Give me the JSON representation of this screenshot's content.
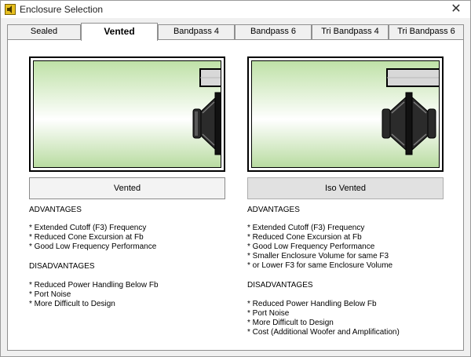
{
  "window": {
    "title": "Enclosure Selection",
    "close_symbol": "✕"
  },
  "tabs": [
    {
      "label": "Sealed",
      "active": false
    },
    {
      "label": "Vented",
      "active": true
    },
    {
      "label": "Bandpass 4",
      "active": false
    },
    {
      "label": "Bandpass 6",
      "active": false
    },
    {
      "label": "Tri Bandpass 4",
      "active": false
    },
    {
      "label": "Tri Bandpass 6",
      "active": false
    }
  ],
  "options": [
    {
      "button_label": "Vented",
      "advantages_heading": "ADVANTAGES",
      "advantages": [
        "* Extended Cutoff (F3) Frequency",
        "* Reduced Cone Excursion at Fb",
        "* Good Low Frequency Performance"
      ],
      "disadvantages_heading": "DISADVANTAGES",
      "disadvantages": [
        "* Reduced Power Handling Below Fb",
        "* Port Noise",
        "* More Difficult to Design"
      ]
    },
    {
      "button_label": "Iso Vented",
      "advantages_heading": "ADVANTAGES",
      "advantages": [
        "* Extended Cutoff (F3) Frequency",
        "* Reduced Cone Excursion at Fb",
        "* Good Low Frequency Performance",
        "* Smaller Enclosure Volume for same F3",
        "* or Lower F3 for same Enclosure Volume"
      ],
      "disadvantages_heading": "DISADVANTAGES",
      "disadvantages": [
        "* Reduced Power Handling Below Fb",
        "* Port Noise",
        "* More Difficult to Design",
        "* Cost (Additional Woofer and Amplification)"
      ]
    }
  ],
  "colors": {
    "enclosure_green": "#bfe1a7",
    "driver_dark": "#1a1a1a",
    "port_gray": "#d8d8d8"
  }
}
